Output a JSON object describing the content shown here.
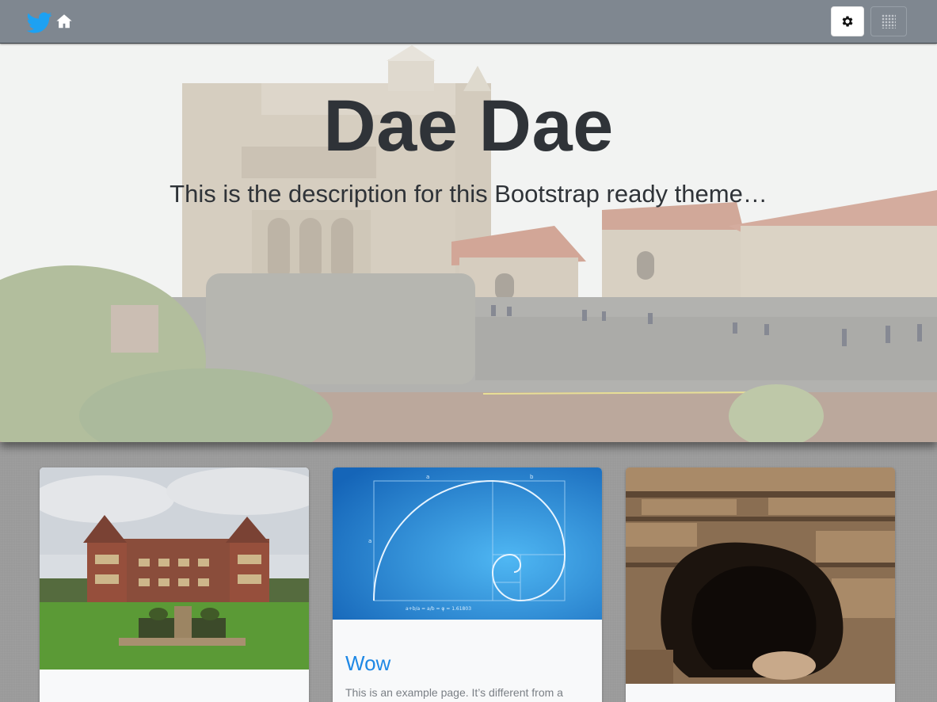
{
  "navbar": {
    "brand_icon": "twitter-bird-icon",
    "home_icon": "home-icon",
    "settings_icon": "gear-icon",
    "apps_icon": "apps-grid-icon",
    "brand_color": "#1da1f2"
  },
  "hero": {
    "title": "Dae Dae",
    "description": "This is the description for this Bootstrap ready theme…"
  },
  "cards": [
    {
      "image": "manor-house-photo"
    },
    {
      "image": "golden-spiral-diagram",
      "title": "Wow",
      "text": "This is an example page. It’s different from a"
    },
    {
      "image": "rock-cave-photo"
    }
  ],
  "spiral": {
    "label_a_top": "a",
    "label_b_top": "b",
    "label_a_left": "a",
    "formula": "a+b/a = a/b = φ = 1.61803"
  }
}
